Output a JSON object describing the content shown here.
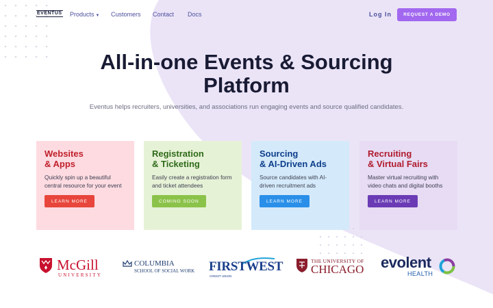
{
  "brand": {
    "logo_text": "EVENTUS"
  },
  "nav": {
    "products": "Products",
    "customers": "Customers",
    "contact": "Contact",
    "docs": "Docs",
    "login": "Log In",
    "demo": "REQUEST A DEMO"
  },
  "hero": {
    "title_line1": "All-in-one Events & Sourcing",
    "title_line2": "Platform",
    "subtitle": "Eventus helps recruiters, universities, and associations run engaging events and source qualified candidates."
  },
  "cards": [
    {
      "title1": "Websites",
      "title2": "& Apps",
      "desc": "Quickly spin up a beautiful central resource for your event",
      "button": "LEARN MORE"
    },
    {
      "title1": "Registration",
      "title2": "& Ticketing",
      "desc": "Easily create a registration form and ticket attendees",
      "button": "COMING SOON"
    },
    {
      "title1": "Sourcing",
      "title2": "& AI-Driven Ads",
      "desc": "Source candidates with AI-driven recruitment ads",
      "button": "LEARN MORE"
    },
    {
      "title1": "Recruiting",
      "title2": "& Virtual Fairs",
      "desc": "Master virtual recruiting with video chats and digital booths",
      "button": "LEARN MORE"
    }
  ],
  "customer_logos": {
    "mcgill": {
      "name": "McGill",
      "sub": "UNIVERSITY"
    },
    "columbia": {
      "name": "COLUMBIA",
      "sub": "SCHOOL OF SOCIAL WORK"
    },
    "firstwest": {
      "name": "FIRSTWEST",
      "sub": "CREDIT UNION"
    },
    "chicago": {
      "top": "THE UNIVERSITY OF",
      "name": "CHICAGO"
    },
    "evolent": {
      "name": "evolent",
      "sub": "HEALTH"
    }
  },
  "colors": {
    "accent": "#a268ef",
    "nav_text": "#4b4f9c",
    "card1_bg": "#fddbe1",
    "card1_title": "#c0202b",
    "card1_btn": "#e8453c",
    "card2_bg": "#e6f2d6",
    "card2_title": "#2f6a1a",
    "card2_btn": "#8bc34a",
    "card3_bg": "#d4eafb",
    "card3_title": "#0e3e8a",
    "card3_btn": "#2a8fe8",
    "card4_bg": "#e7dcf3",
    "card4_title": "#b01a2e",
    "card4_btn": "#6a3bb5"
  }
}
